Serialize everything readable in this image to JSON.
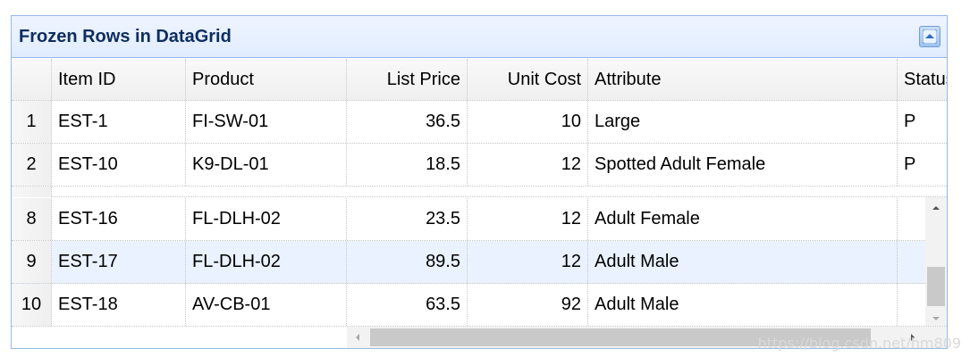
{
  "panel": {
    "title": "Frozen Rows in DataGrid",
    "tool_icon": "collapse-up-icon"
  },
  "columns": [
    "Item ID",
    "Product",
    "List Price",
    "Unit Cost",
    "Attribute",
    "Status"
  ],
  "frozen_rows": [
    {
      "rn": "1",
      "itemid": "EST-1",
      "product": "FI-SW-01",
      "listprice": "36.5",
      "unitcost": "10",
      "attr": "Large",
      "status": "P"
    },
    {
      "rn": "2",
      "itemid": "EST-10",
      "product": "K9-DL-01",
      "listprice": "18.5",
      "unitcost": "12",
      "attr": "Spotted Adult Female",
      "status": "P"
    }
  ],
  "rows": [
    {
      "rn": "8",
      "itemid": "EST-16",
      "product": "FL-DLH-02",
      "listprice": "23.5",
      "unitcost": "12",
      "attr": "Adult Female",
      "status": ""
    },
    {
      "rn": "9",
      "itemid": "EST-17",
      "product": "FL-DLH-02",
      "listprice": "89.5",
      "unitcost": "12",
      "attr": "Adult Male",
      "status": ""
    },
    {
      "rn": "10",
      "itemid": "EST-18",
      "product": "AV-CB-01",
      "listprice": "63.5",
      "unitcost": "92",
      "attr": "Adult Male",
      "status": ""
    }
  ],
  "hovered_row_index": 1,
  "watermark": "https://blog.csdn.net/hm809",
  "colors": {
    "border": "#95b8e7",
    "title": "#0e2d5f",
    "hover": "#eaf2ff"
  }
}
